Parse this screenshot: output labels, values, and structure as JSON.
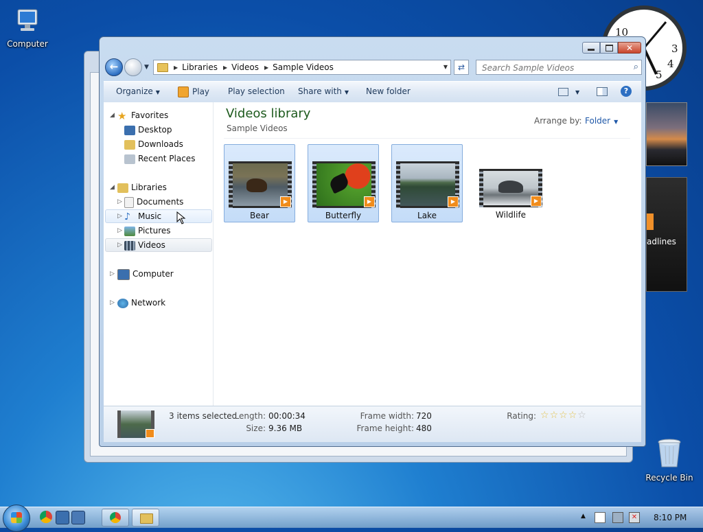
{
  "desktop": {
    "icons": [
      {
        "label": "Computer"
      },
      {
        "label": "Recycle Bin"
      }
    ],
    "gadget_feed_text": "adlines",
    "clock_numbers": [
      "10",
      "3",
      "4",
      "5"
    ]
  },
  "window": {
    "address": {
      "segments": [
        "Libraries",
        "Videos",
        "Sample Videos"
      ]
    },
    "search": {
      "placeholder": "Search Sample Videos"
    },
    "toolbar": {
      "organize": "Organize",
      "play": "Play",
      "play_selection": "Play selection",
      "share_with": "Share with",
      "new_folder": "New folder"
    },
    "nav": {
      "favorites": "Favorites",
      "desktop": "Desktop",
      "downloads": "Downloads",
      "recent_places": "Recent Places",
      "libraries": "Libraries",
      "documents": "Documents",
      "music": "Music",
      "pictures": "Pictures",
      "videos": "Videos",
      "computer": "Computer",
      "network": "Network"
    },
    "library": {
      "title": "Videos library",
      "subtitle": "Sample Videos",
      "arrange_label": "Arrange by:",
      "arrange_value": "Folder"
    },
    "files": [
      {
        "name": "Bear",
        "selected": true
      },
      {
        "name": "Butterfly",
        "selected": true
      },
      {
        "name": "Lake",
        "selected": true
      },
      {
        "name": "Wildlife",
        "selected": false
      }
    ],
    "details": {
      "count": "3 items selected",
      "length_label": "Length:",
      "length": "00:00:34",
      "size_label": "Size:",
      "size": "9.36 MB",
      "frame_width_label": "Frame width:",
      "frame_width": "720",
      "frame_height_label": "Frame height:",
      "frame_height": "480",
      "rating_label": "Rating:",
      "rating_stars": 0
    }
  },
  "taskbar": {
    "time": "8:10 PM"
  }
}
